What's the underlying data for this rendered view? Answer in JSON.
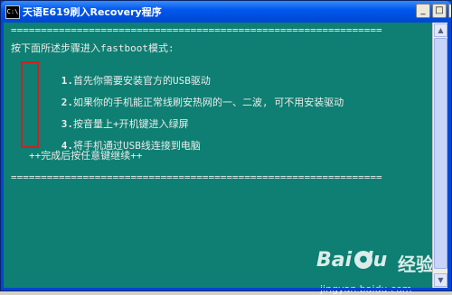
{
  "window": {
    "icon_text": "C:\\",
    "title": "天语E619刷入Recovery程序",
    "minimize_label": "_",
    "maximize_label": "□"
  },
  "console": {
    "separator_top": "==============================================================",
    "intro": "按下面所述步骤进入fastboot模式:",
    "steps": [
      {
        "num": "1.",
        "text": "首先你需要安装官方的USB驱动"
      },
      {
        "num": "2.",
        "text": "如果你的手机能正常线刷安热网的一、二波, 可不用安装驱动"
      },
      {
        "num": "3.",
        "text": "按音量上+开机键进入绿屏"
      },
      {
        "num": "4.",
        "text": "将手机通过USB线连接到电脑"
      }
    ],
    "continue_text": "++完成后按任意键继续++",
    "separator_bottom": "=============================================================="
  },
  "watermark": {
    "logo_text": "Bai   du",
    "paw_text": "●",
    "word": "经验",
    "url": "jingyan.baidu.com"
  },
  "colors": {
    "console_bg": "#0e7f72",
    "console_text": "#ececec",
    "titlebar": "#0058ee",
    "highlight_box": "#d02020"
  }
}
